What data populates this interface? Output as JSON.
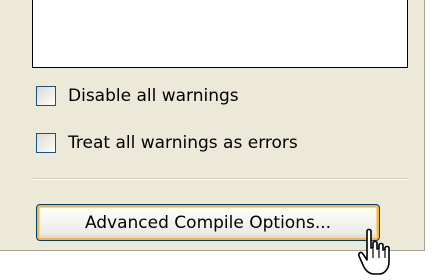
{
  "options": {
    "disable_all_warnings": {
      "label": "Disable all warnings",
      "checked": false
    },
    "treat_warnings_as_errors": {
      "label": "Treat all warnings as errors",
      "checked": false
    }
  },
  "buttons": {
    "advanced_compile_options": "Advanced Compile Options..."
  },
  "icons": {
    "cursor": "hand-pointer-cursor",
    "checkbox": "unchecked-checkbox"
  },
  "colors": {
    "panel_background": "#ECE9D8",
    "checkbox_border": "#1C5180",
    "button_border": "#003C74",
    "button_focus_glow": "#F8B33A"
  }
}
